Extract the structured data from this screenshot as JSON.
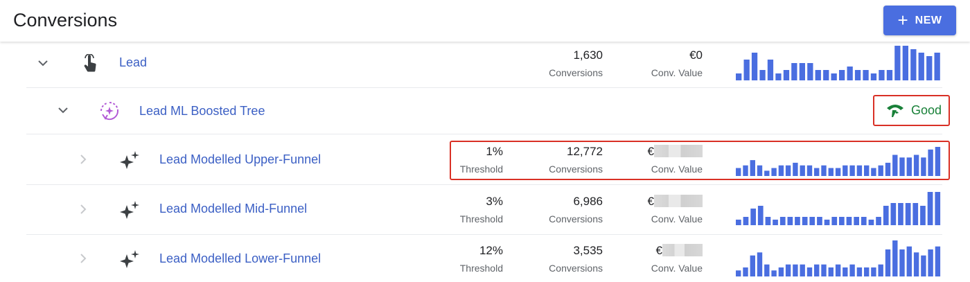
{
  "header": {
    "title": "Conversions",
    "new_button_label": "NEW"
  },
  "colors": {
    "accent": "#4a6ee0",
    "link": "#3b5fc4",
    "bar": "#4a6ee0",
    "good": "#188038",
    "highlight": "#d93025"
  },
  "rows": [
    {
      "name": "Lead",
      "icon": "touch-hand-icon",
      "conversions": "1,630",
      "conversions_label": "Conversions",
      "conv_value": "€0",
      "conv_value_label": "Conv. Value",
      "spark": [
        2,
        6,
        8,
        3,
        6,
        2,
        3,
        5,
        5,
        5,
        3,
        3,
        2,
        3,
        4,
        3,
        3,
        2,
        3,
        3,
        10,
        10,
        9,
        8,
        7,
        8
      ]
    },
    {
      "name": "Lead ML Boosted Tree",
      "icon": "ml-sparkle-cycle-icon",
      "status": "Good",
      "status_icon": "signal-icon"
    },
    {
      "name": "Lead Modelled Upper-Funnel",
      "icon": "sparkle-icon",
      "threshold": "1%",
      "threshold_label": "Threshold",
      "conversions": "12,772",
      "conversions_label": "Conversions",
      "conv_value": "€",
      "conv_value_label": "Conv. Value",
      "spark": [
        3,
        4,
        6,
        4,
        2,
        3,
        4,
        4,
        5,
        4,
        4,
        3,
        4,
        3,
        3,
        4,
        4,
        4,
        4,
        3,
        4,
        5,
        8,
        7,
        7,
        8,
        7,
        10,
        11
      ]
    },
    {
      "name": "Lead Modelled Mid-Funnel",
      "icon": "sparkle-icon",
      "threshold": "3%",
      "threshold_label": "Threshold",
      "conversions": "6,986",
      "conversions_label": "Conversions",
      "conv_value": "€",
      "conv_value_label": "Conv. Value",
      "spark": [
        2,
        3,
        6,
        7,
        3,
        2,
        3,
        3,
        3,
        3,
        3,
        3,
        2,
        3,
        3,
        3,
        3,
        3,
        2,
        3,
        7,
        8,
        8,
        8,
        8,
        7,
        12,
        12
      ]
    },
    {
      "name": "Lead Modelled Lower-Funnel",
      "icon": "sparkle-icon",
      "threshold": "12%",
      "threshold_label": "Threshold",
      "conversions": "3,535",
      "conversions_label": "Conversions",
      "conv_value": "€",
      "conv_value_label": "Conv. Value",
      "spark": [
        2,
        3,
        7,
        8,
        4,
        2,
        3,
        4,
        4,
        4,
        3,
        4,
        4,
        3,
        4,
        3,
        4,
        3,
        3,
        3,
        4,
        9,
        12,
        9,
        10,
        8,
        7,
        9,
        10
      ]
    }
  ]
}
